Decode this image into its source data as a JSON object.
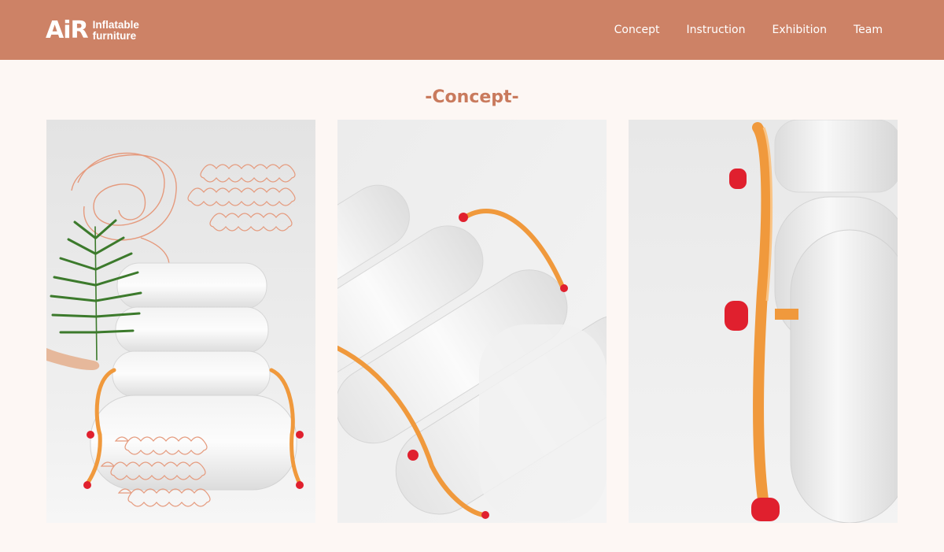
{
  "brand": {
    "mark": "AiR",
    "line1": "Inflatable",
    "line2": "furniture"
  },
  "nav": {
    "items": [
      {
        "label": "Concept"
      },
      {
        "label": "Instruction"
      },
      {
        "label": "Exhibition"
      },
      {
        "label": "Team"
      }
    ]
  },
  "section": {
    "title": "-Concept-"
  },
  "colors": {
    "header_bg": "#cd8266",
    "page_bg": "#fdf7f4",
    "accent": "#c97a5d",
    "frame_orange": "#f0993c",
    "cap_red": "#e0202e"
  },
  "gallery": {
    "images": [
      {
        "subject": "inflatable-chair-with-palm-leaf"
      },
      {
        "subject": "chair-armrest-closeup"
      },
      {
        "subject": "chair-side-frame-closeup"
      }
    ]
  }
}
